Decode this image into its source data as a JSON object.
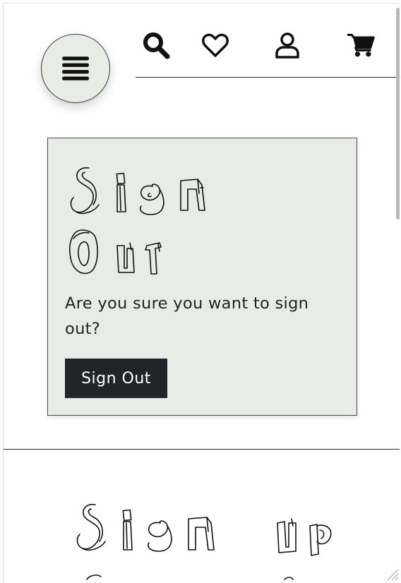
{
  "nav": {
    "menu_icon": "hamburger-icon",
    "icons": [
      "search-icon",
      "heart-icon",
      "user-icon",
      "cart-icon"
    ]
  },
  "signout": {
    "title_line1": "Sign",
    "title_line2": "Out",
    "message": "Are you sure you want to sign out?",
    "button_label": "Sign Out"
  },
  "signup": {
    "title": "Sign Up"
  },
  "colors": {
    "card_bg": "#e8ece6",
    "button_bg": "#212529",
    "menu_bg": "#e7ece5"
  }
}
